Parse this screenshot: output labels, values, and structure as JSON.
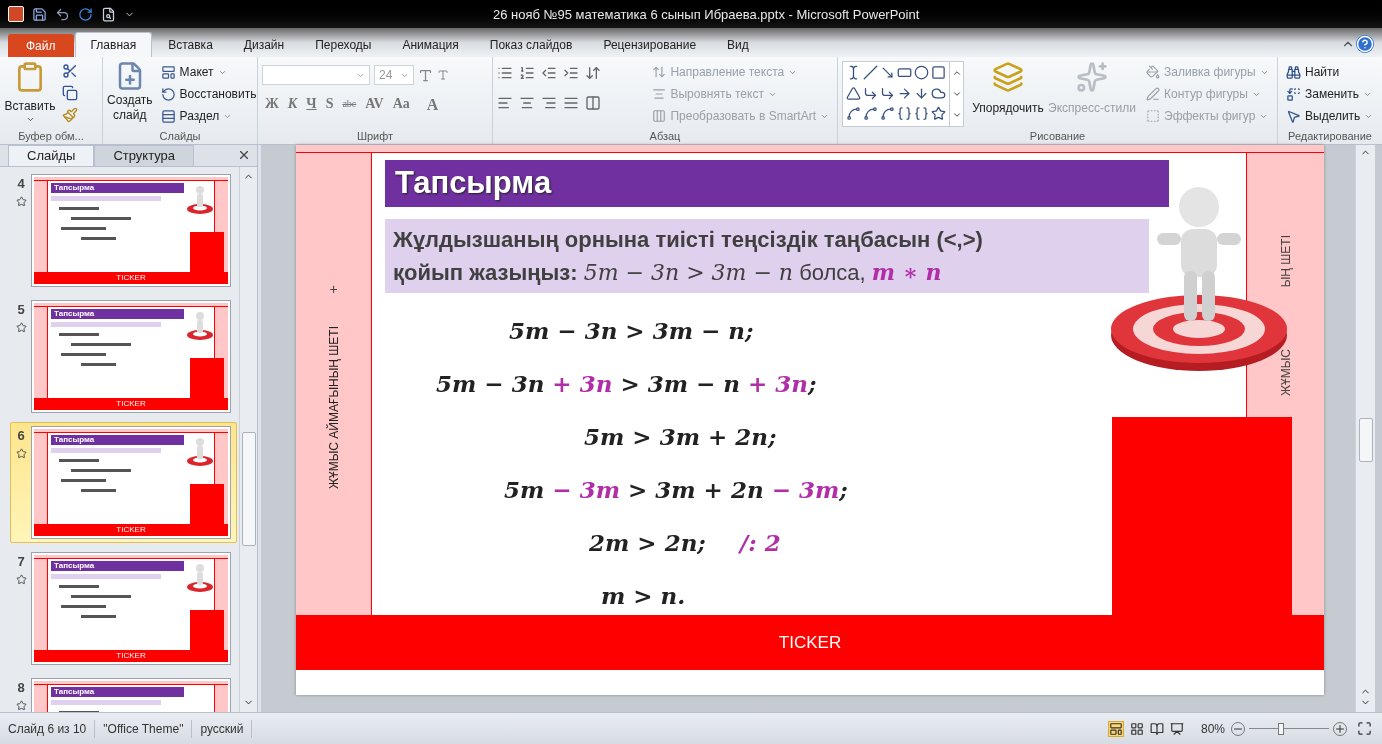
{
  "window": {
    "title": "26 нояб №95 математика 6 сынып Ибраева.pptx - Microsoft PowerPoint"
  },
  "ribbon_tabs": [
    {
      "label": "Файл",
      "kind": "file",
      "selected": false
    },
    {
      "label": "Главная",
      "kind": "tab",
      "selected": true
    },
    {
      "label": "Вставка",
      "kind": "tab",
      "selected": false
    },
    {
      "label": "Дизайн",
      "kind": "tab",
      "selected": false
    },
    {
      "label": "Переходы",
      "kind": "tab",
      "selected": false
    },
    {
      "label": "Анимация",
      "kind": "tab",
      "selected": false
    },
    {
      "label": "Показ слайдов",
      "kind": "tab",
      "selected": false
    },
    {
      "label": "Рецензирование",
      "kind": "tab",
      "selected": false
    },
    {
      "label": "Вид",
      "kind": "tab",
      "selected": false
    }
  ],
  "clipboard": {
    "label": "Буфер обм...",
    "paste": "Вставить"
  },
  "slides_group": {
    "label": "Слайды",
    "new_slide": "Создать слайд",
    "items": [
      "Макет",
      "Восстановить",
      "Раздел"
    ]
  },
  "font": {
    "label": "Шрифт",
    "size": "24",
    "buttons": [
      "Ж",
      "К",
      "Ч",
      "S",
      "abc",
      "AV",
      "Aa",
      "A"
    ]
  },
  "paragraph": {
    "label": "Абзац",
    "items": [
      {
        "label": "Направление текста",
        "disabled": true
      },
      {
        "label": "Выровнять текст",
        "disabled": true
      },
      {
        "label": "Преобразовать в SmartArt",
        "disabled": true
      }
    ]
  },
  "drawing": {
    "label": "Рисование",
    "arrange": "Упорядочить",
    "quick_styles": {
      "label": "Экспресс-стили",
      "disabled": true
    },
    "items": [
      {
        "label": "Заливка фигуры",
        "disabled": true
      },
      {
        "label": "Контур фигуры",
        "disabled": true
      },
      {
        "label": "Эффекты фигур",
        "disabled": true
      }
    ]
  },
  "editing": {
    "label": "Редактирование",
    "items": [
      "Найти",
      "Заменить",
      "Выделить"
    ]
  },
  "panel": {
    "tabs": [
      {
        "label": "Слайды",
        "selected": true
      },
      {
        "label": "Структура",
        "selected": false
      }
    ],
    "thumbnails": [
      {
        "number": "4",
        "title": "Тапсырма",
        "ticker": "TICKER",
        "selected": false
      },
      {
        "number": "5",
        "title": "Тапсырма",
        "ticker": "TICKER",
        "selected": false
      },
      {
        "number": "6",
        "title": "Тапсырма",
        "ticker": "TICKER",
        "selected": true
      },
      {
        "number": "7",
        "title": "Тапсырма",
        "ticker": "TICKER",
        "selected": false
      },
      {
        "number": "8",
        "title": "Тапсырма",
        "selected": false
      }
    ]
  },
  "slide": {
    "margin_left": "ЖҰМЫС АЙМАҒЫНЫҢ ШЕТІ",
    "plus": "+",
    "margin_right": [
      "ЫҢ ШЕТІ",
      "ЖҰМЫС"
    ],
    "title": "Тапсырма",
    "task": [
      [
        {
          "kind": "text",
          "t": "Жұлдызшаның орнына тиісті теңсіздік таңбасын (<,>)"
        }
      ],
      [
        {
          "kind": "text",
          "t": "қойып жазыңыз: "
        },
        {
          "kind": "math",
          "t": "5m − 3n > 3m − n"
        },
        {
          "kind": "plain",
          "t": " болса, "
        },
        {
          "kind": "accent",
          "t": "m ∗ n"
        }
      ]
    ],
    "equations": [
      [
        {
          "t": "5m − 3n > 3m − n;",
          "highlight": false
        }
      ],
      [
        {
          "t": "5m − 3n ",
          "highlight": false
        },
        {
          "t": "+ 3n",
          "highlight": true
        },
        {
          "t": " > 3m − n ",
          "highlight": false
        },
        {
          "t": "+ 3n",
          "highlight": true
        },
        {
          "t": ";",
          "highlight": false
        }
      ],
      [
        {
          "t": "5m > 3m + 2n;",
          "highlight": false
        }
      ],
      [
        {
          "t": "5m ",
          "highlight": false
        },
        {
          "t": "− 3m",
          "highlight": true
        },
        {
          "t": " > 3m + 2n ",
          "highlight": false
        },
        {
          "t": "− 3m",
          "highlight": true
        },
        {
          "t": ";",
          "highlight": false
        }
      ],
      [
        {
          "t": "2m > 2n;",
          "highlight": false
        }
      ],
      [
        {
          "t": "m > n.",
          "highlight": false
        }
      ]
    ],
    "note": "/: 2",
    "ticker": "TICKER"
  },
  "status_bar": {
    "slide": "Слайд 6 из 10",
    "theme": "\"Office Theme\"",
    "language": "русский",
    "zoom": "80%",
    "zoom_slider": {
      "level": 0.4
    }
  }
}
